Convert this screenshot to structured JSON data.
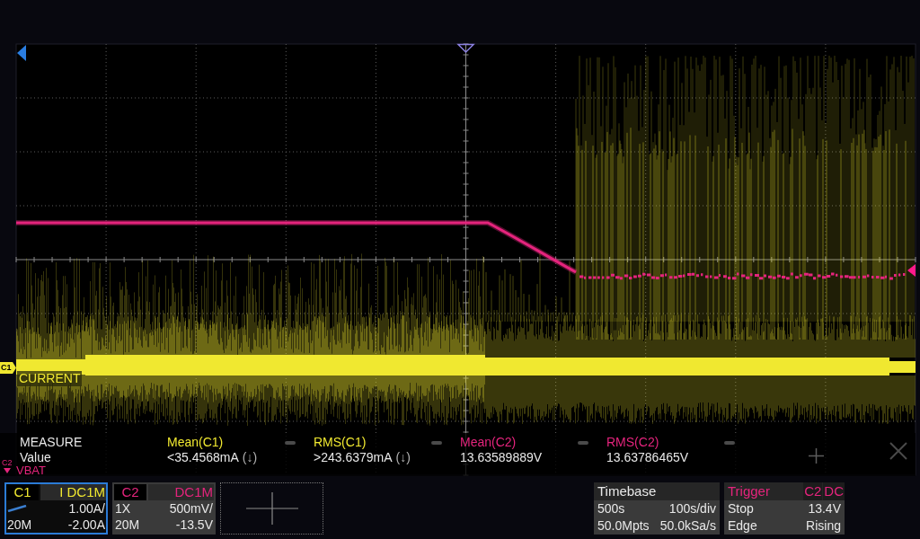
{
  "channel_labels": [
    {
      "tag": "C1",
      "name": "CURRENT",
      "color": "#f0e830",
      "offscreen": false
    },
    {
      "tag": "C2",
      "name": "VBAT",
      "color": "#e5247d",
      "offscreen": true
    }
  ],
  "measure": {
    "title": "MEASURE",
    "row_label": "Value",
    "items": [
      {
        "name": "Mean(C1)",
        "value": "<35.4568mA",
        "trend": "(↓)",
        "color": "#f0e830"
      },
      {
        "name": "RMS(C1)",
        "value": ">243.6379mA",
        "trend": "(↓)",
        "color": "#f0e830"
      },
      {
        "name": "Mean(C2)",
        "value": "13.63589889V",
        "color": "#e5247d"
      },
      {
        "name": "RMS(C2)",
        "value": "13.63786465V",
        "color": "#e5247d"
      }
    ]
  },
  "channels": [
    {
      "label": "C1",
      "kind": "current",
      "coupling": "I DC1M",
      "scale": "1.00A/",
      "bandwidth_limit": "20M",
      "offset": "-2.00A",
      "color": "#f0e830",
      "selected": true
    },
    {
      "label": "C2",
      "kind": "voltage",
      "probe": "1X",
      "coupling": "DC1M",
      "scale": "500mV/",
      "bandwidth_limit": "20M",
      "offset": "-13.5V",
      "color": "#e5247d",
      "selected": false
    }
  ],
  "timebase": {
    "title": "Timebase",
    "delay": "500s",
    "scale": "100s/div",
    "memory_depth": "50.0Mpts",
    "sample_rate": "50.0kSa/s"
  },
  "trigger": {
    "title": "Trigger",
    "source": "C2",
    "coupling": "DC",
    "state": "Stop",
    "trigger_level": "13.4V",
    "type": "Edge",
    "slope": "Rising"
  }
}
